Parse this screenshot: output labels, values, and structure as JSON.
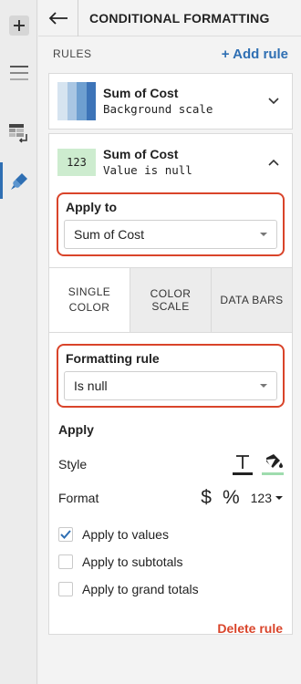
{
  "header": {
    "title": "CONDITIONAL FORMATTING"
  },
  "rules": {
    "label": "RULES",
    "add_label": "+ Add rule"
  },
  "rule_list": [
    {
      "name": "Sum of Cost",
      "description": "Background scale",
      "swatch_colors": [
        "#d6e4f0",
        "#a9c6e3",
        "#6e9fd0",
        "#3d74b8"
      ]
    },
    {
      "name": "Sum of Cost",
      "description": "Value is null",
      "swatch_text": "123",
      "swatch_color": "#cdeccf"
    }
  ],
  "editor": {
    "apply_to": {
      "label": "Apply to",
      "value": "Sum of Cost"
    },
    "tabs": [
      {
        "label_line1": "SINGLE",
        "label_line2": "COLOR"
      },
      {
        "label_line1": "COLOR SCALE",
        "label_line2": ""
      },
      {
        "label_line1": "DATA BARS",
        "label_line2": ""
      }
    ],
    "formatting_rule": {
      "label": "Formatting rule",
      "value": "Is null"
    },
    "apply": {
      "title": "Apply",
      "style_label": "Style",
      "format_label": "Format",
      "format_currency": "$",
      "format_percent": "%",
      "format_number": "123",
      "checkboxes": [
        {
          "label": "Apply to values",
          "checked": true
        },
        {
          "label": "Apply to subtotals",
          "checked": false
        },
        {
          "label": "Apply to grand totals",
          "checked": false
        }
      ]
    },
    "delete_label": "Delete rule"
  },
  "colors": {
    "accent": "#2f6fb3",
    "danger": "#d9442a",
    "fill_green": "#9fdcae"
  }
}
